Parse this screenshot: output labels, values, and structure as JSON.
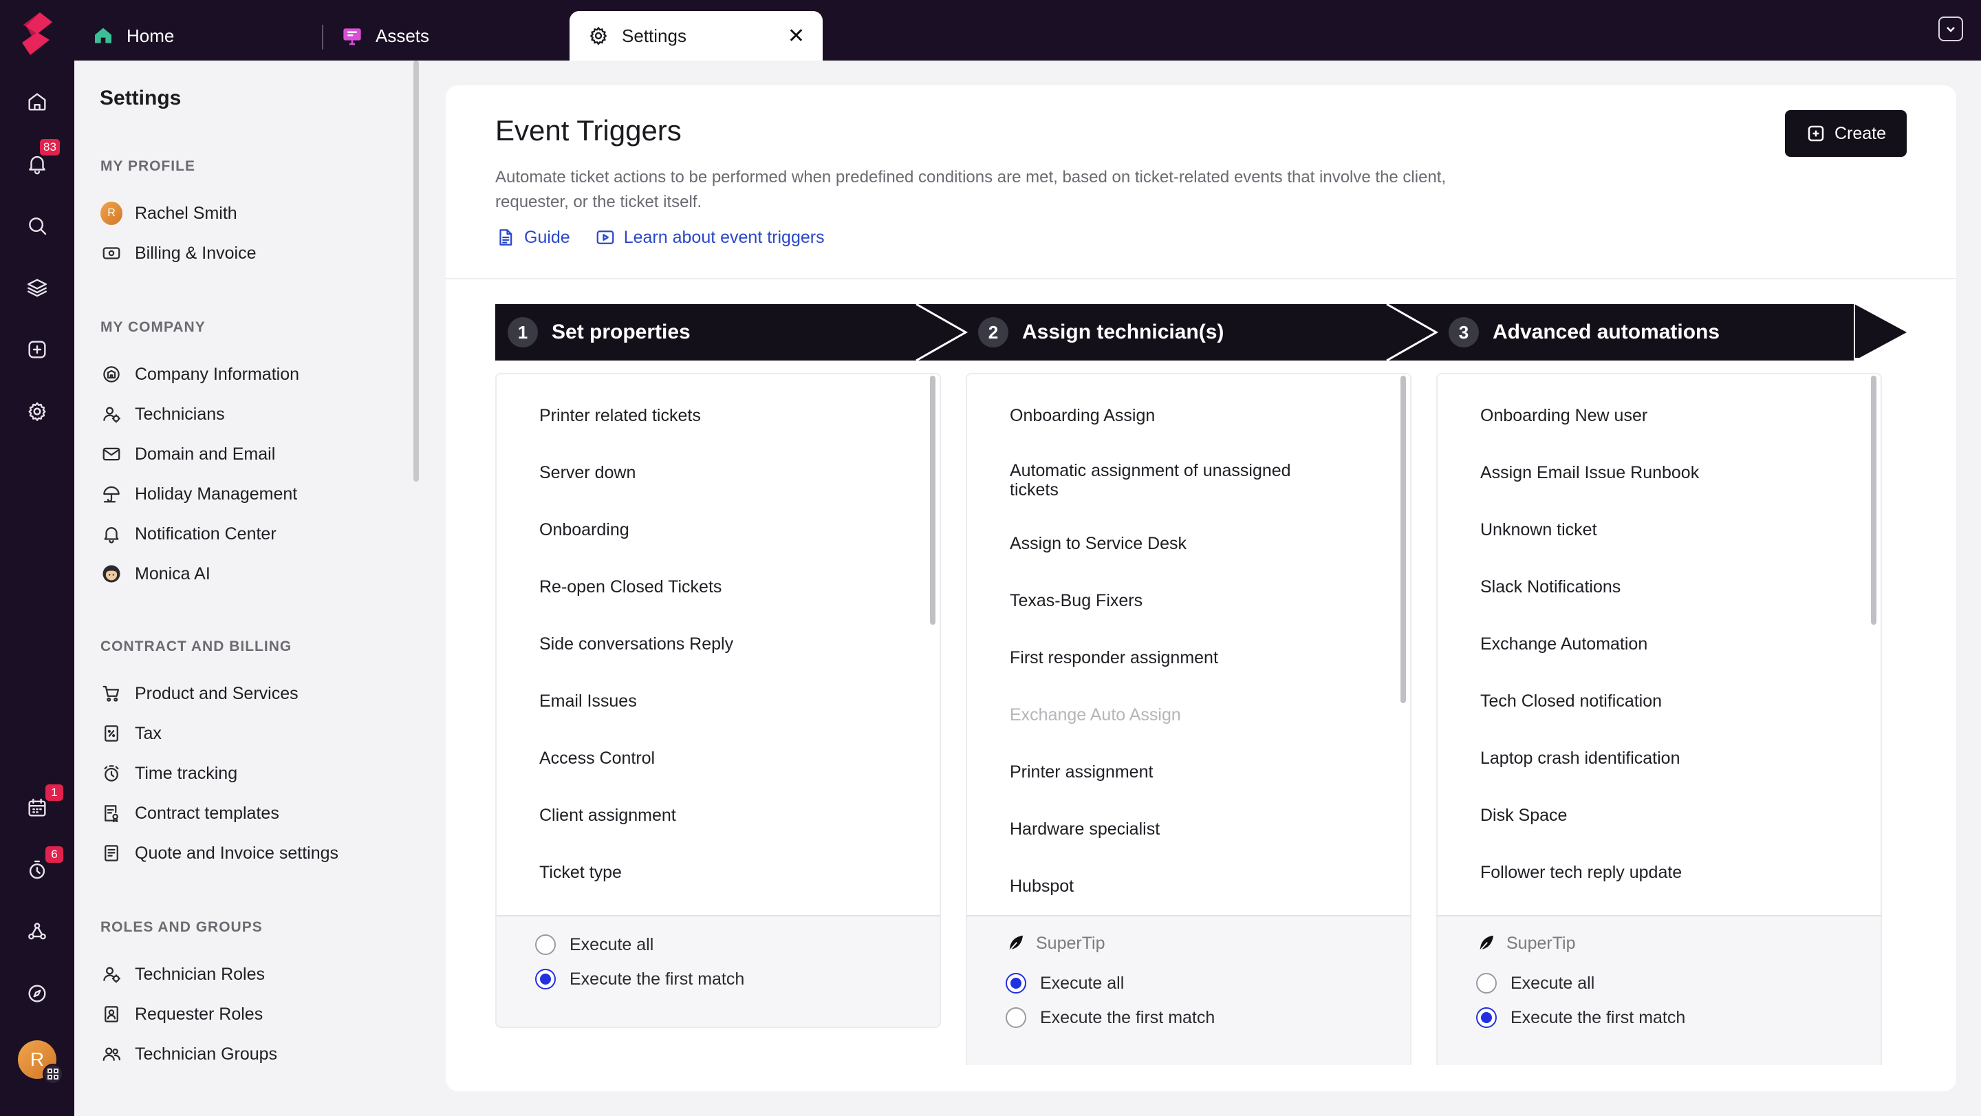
{
  "rail": {
    "notifications_badge": "83",
    "calendar_badge": "1",
    "timer_badge": "6",
    "avatar_initial": "R"
  },
  "tabs": [
    {
      "label": "Home"
    },
    {
      "label": "Assets"
    },
    {
      "label": "Settings"
    }
  ],
  "sidebar": {
    "title": "Settings",
    "sections": [
      {
        "label": "MY PROFILE",
        "items": [
          {
            "label": "Rachel Smith",
            "avatar": "R"
          },
          {
            "label": "Billing & Invoice"
          }
        ]
      },
      {
        "label": "MY COMPANY",
        "items": [
          {
            "label": "Company Information"
          },
          {
            "label": "Technicians"
          },
          {
            "label": "Domain and Email"
          },
          {
            "label": "Holiday Management"
          },
          {
            "label": "Notification Center"
          },
          {
            "label": "Monica AI"
          }
        ]
      },
      {
        "label": "CONTRACT AND BILLING",
        "items": [
          {
            "label": "Product and Services"
          },
          {
            "label": "Tax"
          },
          {
            "label": "Time tracking"
          },
          {
            "label": "Contract templates"
          },
          {
            "label": "Quote and Invoice settings"
          }
        ]
      },
      {
        "label": "ROLES AND GROUPS",
        "items": [
          {
            "label": "Technician Roles"
          },
          {
            "label": "Requester Roles"
          },
          {
            "label": "Technician Groups"
          }
        ]
      }
    ]
  },
  "main": {
    "title": "Event Triggers",
    "description": "Automate ticket actions to be performed when predefined conditions are met, based on ticket-related events that involve the client, requester, or the ticket itself.",
    "guide_label": "Guide",
    "learn_label": "Learn about event triggers",
    "create_label": "Create",
    "steps": [
      {
        "num": "1",
        "label": "Set properties"
      },
      {
        "num": "2",
        "label": "Assign technician(s)"
      },
      {
        "num": "3",
        "label": "Advanced automations"
      }
    ],
    "columns": [
      {
        "items": [
          "Printer related tickets",
          "Server down",
          "Onboarding",
          "Re-open Closed Tickets",
          "Side conversations Reply",
          "Email Issues",
          "Access Control",
          "Client assignment",
          "Ticket type"
        ],
        "supertip": "",
        "execute_all": "Execute all",
        "execute_first": "Execute the first match",
        "selected": "first"
      },
      {
        "items": [
          "Onboarding Assign",
          "Automatic assignment of unassigned tickets",
          "Assign to Service Desk",
          "Texas-Bug Fixers",
          "First responder assignment",
          "Exchange Auto Assign",
          "Printer assignment",
          "Hardware specialist",
          "Hubspot"
        ],
        "disabled_item": "Exchange Auto Assign",
        "supertip": "SuperTip",
        "execute_all": "Execute all",
        "execute_first": "Execute the first match",
        "selected": "all"
      },
      {
        "items": [
          "Onboarding New user",
          "Assign Email Issue Runbook",
          "Unknown ticket",
          "Slack Notifications",
          "Exchange Automation",
          "Tech Closed notification",
          "Laptop crash identification",
          "Disk Space",
          "Follower tech reply update"
        ],
        "supertip": "SuperTip",
        "execute_all": "Execute all",
        "execute_first": "Execute the first match",
        "selected": "first"
      }
    ]
  },
  "colors": {
    "rail_bg": "#1a0f24",
    "accent_red": "#e0224d",
    "link_blue": "#2a47c9",
    "radio_blue": "#2130e0",
    "banner_bg": "#14101a"
  }
}
